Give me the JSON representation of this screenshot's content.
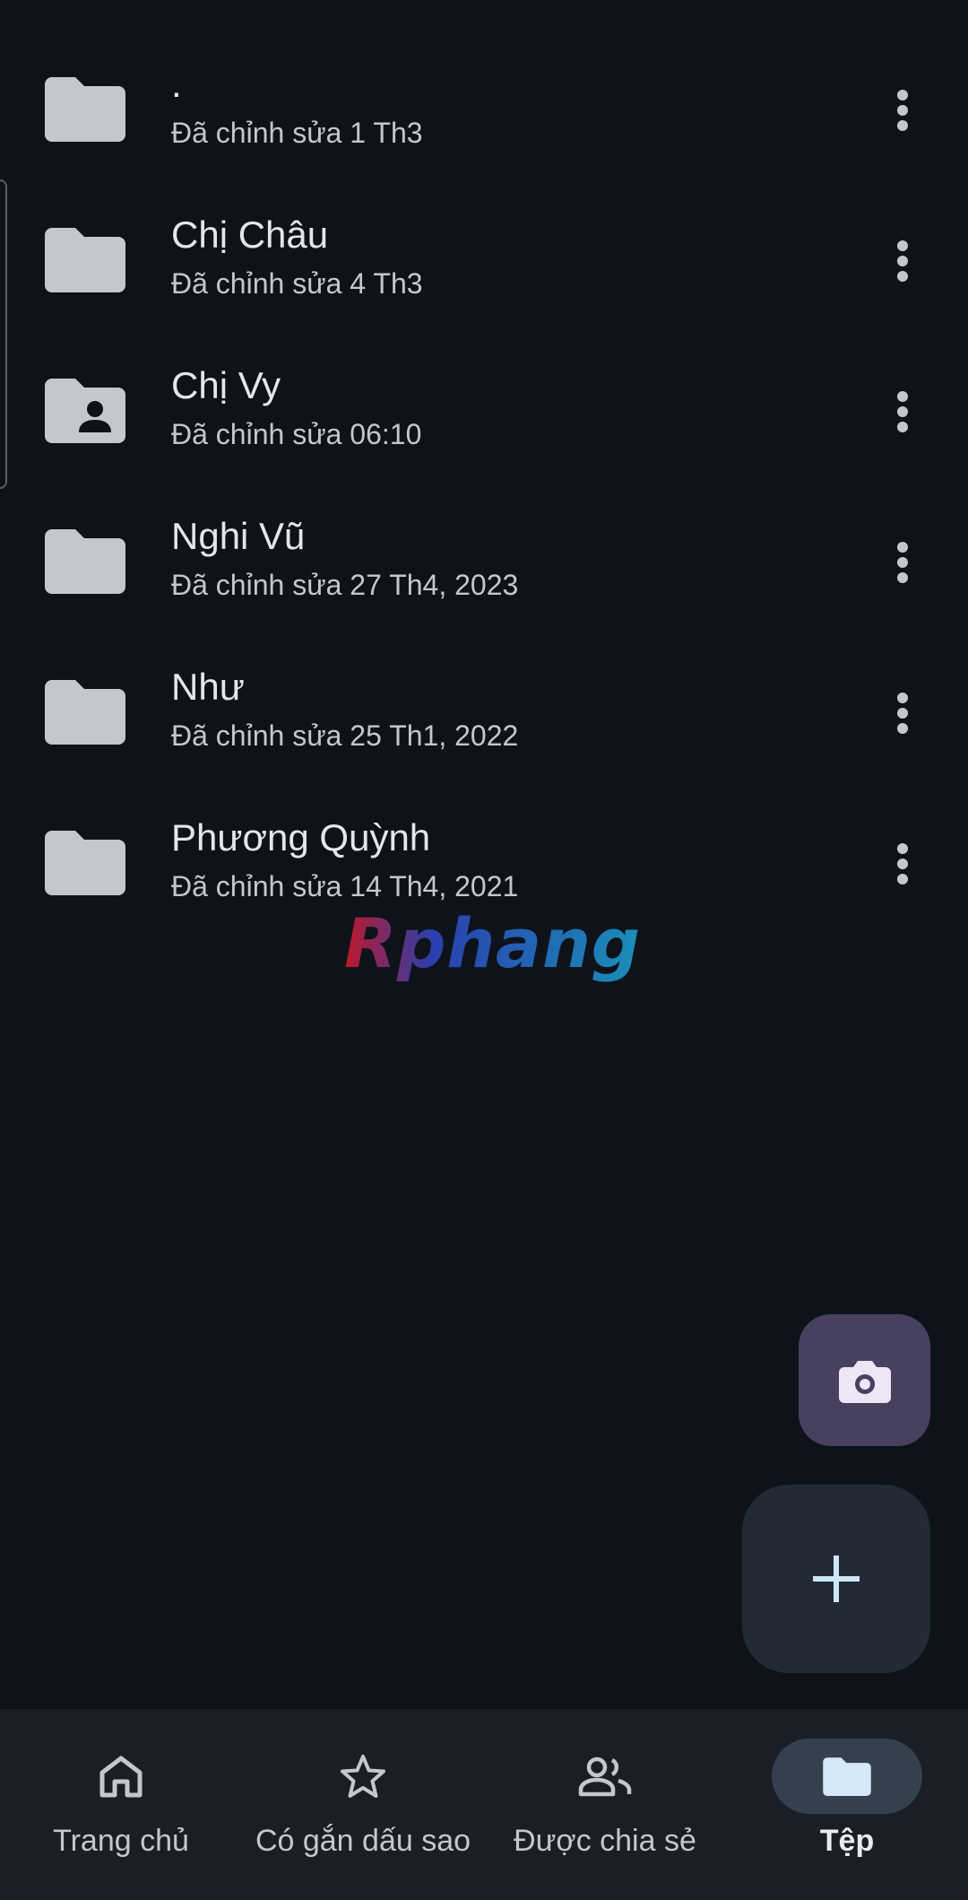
{
  "files": [
    {
      "name": ".",
      "modified": "Đã chỉnh sửa 1 Th3",
      "icon": "folder-icon"
    },
    {
      "name": "Chị Châu",
      "modified": "Đã chỉnh sửa 4 Th3",
      "icon": "folder-icon"
    },
    {
      "name": "Chị Vy",
      "modified": "Đã chỉnh sửa 06:10",
      "icon": "shared-folder-icon"
    },
    {
      "name": "Nghi Vũ",
      "modified": "Đã chỉnh sửa 27 Th4, 2023",
      "icon": "folder-icon"
    },
    {
      "name": "Như",
      "modified": "Đã chỉnh sửa 25 Th1, 2022",
      "icon": "folder-icon"
    },
    {
      "name": "Phương Quỳnh",
      "modified": "Đã chỉnh sửa 14 Th4, 2021",
      "icon": "folder-icon"
    }
  ],
  "watermark": "Rphang",
  "fab": {
    "camera_icon": "camera-icon",
    "add_icon": "plus-icon"
  },
  "bottom_nav": [
    {
      "label": "Trang chủ",
      "icon": "home-icon",
      "active": false
    },
    {
      "label": "Có gắn dấu sao",
      "icon": "star-icon",
      "active": false
    },
    {
      "label": "Được chia sẻ",
      "icon": "people-icon",
      "active": false
    },
    {
      "label": "Tệp",
      "icon": "folder-icon",
      "active": true
    }
  ],
  "colors": {
    "background": "#0e131b",
    "folder": "#c4c8ce",
    "fab_camera": "#48405f",
    "fab_add": "#232a33",
    "nav_bg": "#1a1f27",
    "nav_active_pill": "#34404d"
  }
}
